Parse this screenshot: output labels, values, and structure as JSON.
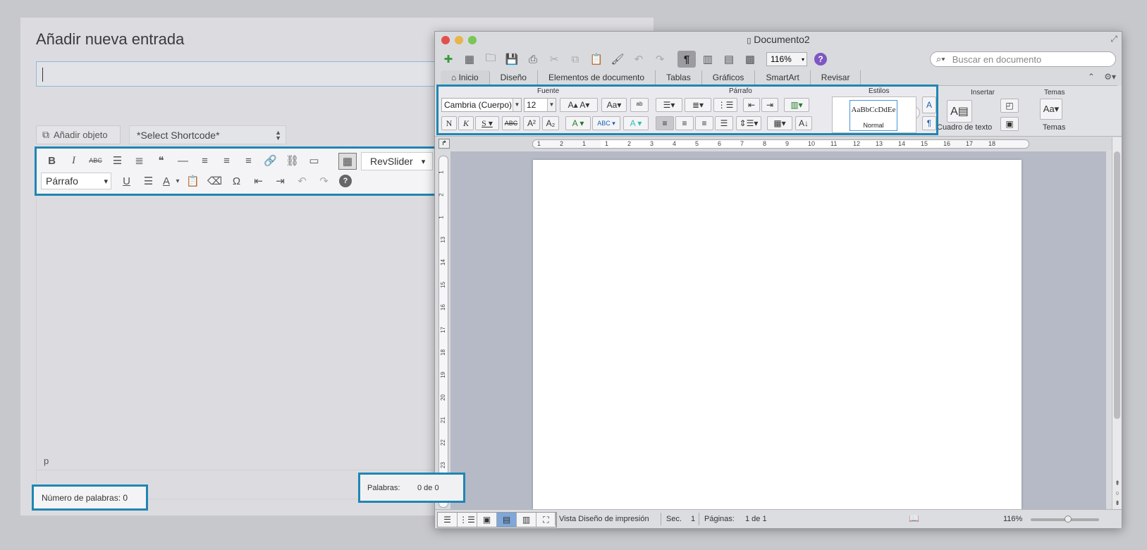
{
  "wordpress": {
    "page_title": "Añadir nueva entrada",
    "add_object_label": "Añadir objeto",
    "shortcode_select": "*Select Shortcode*",
    "toolbar": {
      "row1": [
        {
          "name": "bold-button",
          "glyph": "B"
        },
        {
          "name": "italic-button",
          "glyph": "I"
        },
        {
          "name": "strikethrough-button",
          "glyph": "ABC"
        },
        {
          "name": "bullet-list-button",
          "glyph": "☰"
        },
        {
          "name": "numbered-list-button",
          "glyph": "≣"
        },
        {
          "name": "blockquote-button",
          "glyph": "❝"
        },
        {
          "name": "horizontal-line-button",
          "glyph": "—"
        },
        {
          "name": "align-left-button",
          "glyph": "≡"
        },
        {
          "name": "align-center-button",
          "glyph": "≡"
        },
        {
          "name": "align-right-button",
          "glyph": "≡"
        },
        {
          "name": "insert-link-button",
          "glyph": "🔗"
        },
        {
          "name": "remove-link-button",
          "glyph": "⛓"
        },
        {
          "name": "read-more-button",
          "glyph": "▭"
        }
      ],
      "toolbar_toggle_glyph": "▦",
      "revslider_label": "RevSlider",
      "revslider_arrow": "▾",
      "format_select": "Párrafo",
      "format_arrow": "▾",
      "row2": [
        {
          "name": "underline-button",
          "glyph": "U"
        },
        {
          "name": "justify-button",
          "glyph": "☰"
        },
        {
          "name": "text-color-button",
          "glyph": "A"
        },
        {
          "name": "text-color-arrow",
          "glyph": "▾"
        },
        {
          "name": "paste-text-button",
          "glyph": "📋"
        },
        {
          "name": "clear-format-button",
          "glyph": "⌫"
        },
        {
          "name": "special-char-button",
          "glyph": "Ω"
        },
        {
          "name": "outdent-button",
          "glyph": "⇤"
        },
        {
          "name": "indent-button",
          "glyph": "⇥"
        },
        {
          "name": "undo-button",
          "glyph": "↶"
        },
        {
          "name": "redo-button",
          "glyph": "↷"
        },
        {
          "name": "help-button",
          "glyph": "?"
        }
      ]
    },
    "path_label": "p",
    "word_count": "Número de palabras: 0"
  },
  "word": {
    "window_title": "Documento2",
    "zoom": "116%",
    "search_placeholder": "Buscar en documento",
    "tabs": [
      "Inicio",
      "Diseño",
      "Elementos de documento",
      "Tablas",
      "Gráficos",
      "SmartArt",
      "Revisar"
    ],
    "ribbon": {
      "fuente_label": "Fuente",
      "parrafo_label": "Párrafo",
      "estilos_label": "Estilos",
      "insertar_label": "Insertar",
      "temas_group_label": "Temas",
      "font_name": "Cambria (Cuerpo)",
      "font_size": "12",
      "style_preview": "AaBbCcDdEe",
      "style_name": "Normal",
      "textbox_label": "Cuadro de texto",
      "temas_button": "Temas"
    },
    "ruler_numbers": [
      "1",
      "2",
      "1",
      "1",
      "2",
      "3",
      "4",
      "5",
      "6",
      "7",
      "8",
      "9",
      "10",
      "11",
      "12",
      "13",
      "14",
      "15",
      "16",
      "17",
      "18"
    ],
    "vruler_numbers": [
      "1",
      "2",
      "1",
      "13",
      "14",
      "15",
      "16",
      "17",
      "18",
      "19",
      "20",
      "21",
      "22",
      "23",
      "24"
    ],
    "status": {
      "view_name": "Vista Diseño de impresión",
      "sec_label": "Sec.",
      "sec_value": "1",
      "pages_label": "Páginas:",
      "pages_value": "1 de 1",
      "words_label": "Palabras:",
      "words_value": "0 de 0",
      "zoom_value": "116%"
    }
  },
  "colors": {
    "highlight": "#1f86b3"
  }
}
